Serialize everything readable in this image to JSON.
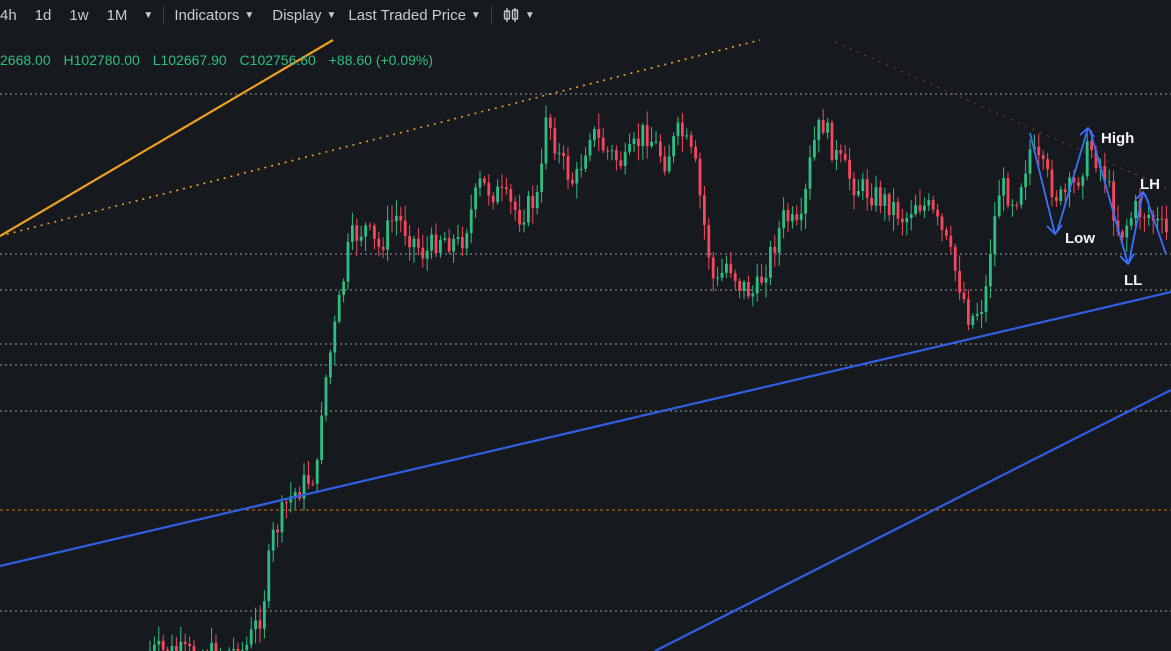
{
  "toolbar": {
    "intervals": [
      "4h",
      "1d",
      "1w"
    ],
    "month": "1M",
    "indicators": "Indicators",
    "display": "Display",
    "price_type": "Last Traded Price"
  },
  "ohlc": {
    "open": "2668.00",
    "high": "H102780.00",
    "low": "L102667.90",
    "close": "C102756.60",
    "change": "+88.60 (+0.09%)"
  },
  "annotations": {
    "high": "High",
    "low": "Low",
    "lh": "LH",
    "ll": "LL"
  },
  "colors": {
    "background": "#161a1e",
    "up": "#2ebd85",
    "down": "#f6465d",
    "trendline_blue": "#2f5fe3",
    "trendline_orange": "#f0a020"
  }
}
